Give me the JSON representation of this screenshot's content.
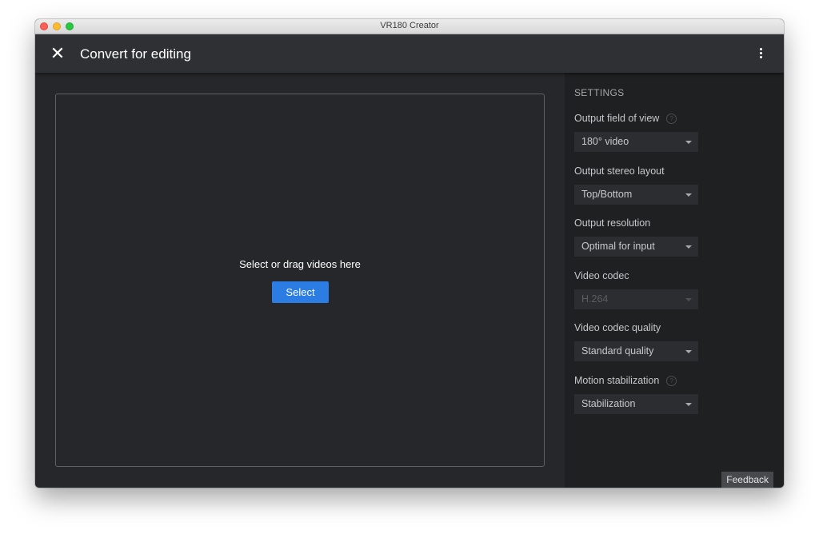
{
  "window": {
    "title": "VR180 Creator"
  },
  "appbar": {
    "title": "Convert for editing",
    "close_icon": "close-icon",
    "more_icon": "more-vert-icon"
  },
  "dropzone": {
    "text": "Select or drag videos here",
    "button_label": "Select"
  },
  "settings": {
    "heading": "SETTINGS",
    "fields": [
      {
        "label": "Output field of view",
        "value": "180° video",
        "help": true,
        "disabled": false
      },
      {
        "label": "Output stereo layout",
        "value": "Top/Bottom",
        "help": false,
        "disabled": false
      },
      {
        "label": "Output resolution",
        "value": "Optimal for input",
        "help": false,
        "disabled": false
      },
      {
        "label": "Video codec",
        "value": "H.264",
        "help": false,
        "disabled": true
      },
      {
        "label": "Video codec quality",
        "value": "Standard quality",
        "help": false,
        "disabled": false
      },
      {
        "label": "Motion stabilization",
        "value": "Stabilization",
        "help": true,
        "disabled": false
      }
    ]
  },
  "feedback": {
    "label": "Feedback"
  },
  "colors": {
    "accent": "#2b7de3",
    "background": "#26272a",
    "panel": "#1f2022"
  }
}
